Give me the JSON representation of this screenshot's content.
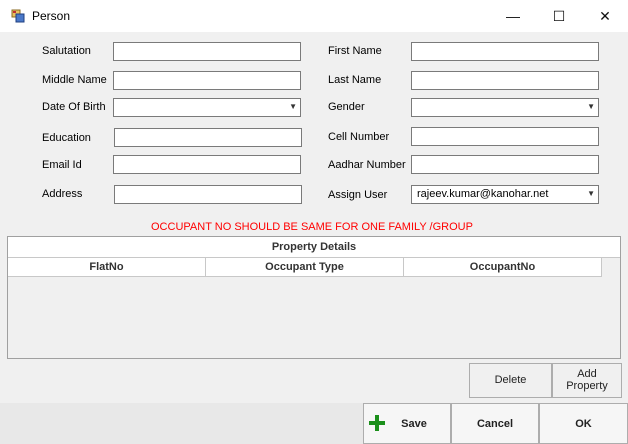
{
  "window": {
    "title": "Person",
    "minimize": "—",
    "maximize": "☐",
    "close": "✕"
  },
  "fields": {
    "salutation": {
      "label": "Salutation",
      "value": ""
    },
    "first_name": {
      "label": "First Name",
      "value": ""
    },
    "middle_name": {
      "label": "Middle Name",
      "value": ""
    },
    "last_name": {
      "label": "Last Name",
      "value": ""
    },
    "dob": {
      "label": "Date Of Birth",
      "value": ""
    },
    "gender": {
      "label": "Gender",
      "value": ""
    },
    "education": {
      "label": "Education",
      "value": ""
    },
    "cell_number": {
      "label": "Cell Number",
      "value": ""
    },
    "email": {
      "label": "Email Id",
      "value": ""
    },
    "aadhar": {
      "label": "Aadhar Number",
      "value": ""
    },
    "address": {
      "label": "Address",
      "value": ""
    },
    "assign_user": {
      "label": "Assign User",
      "value": "rajeev.kumar@kanohar.net"
    }
  },
  "warning": "OCCUPANT NO SHOULD BE SAME FOR ONE FAMILY /GROUP",
  "grid": {
    "title": "Property Details",
    "columns": [
      "FlatNo",
      "Occupant Type",
      "OccupantNo"
    ]
  },
  "actions": {
    "delete": "Delete",
    "add_property_line1": "Add",
    "add_property_line2": "Property",
    "save": "Save",
    "cancel": "Cancel",
    "ok": "OK"
  },
  "colors": {
    "warning": "#ff0000",
    "save_icon": "#1a8f1a"
  }
}
